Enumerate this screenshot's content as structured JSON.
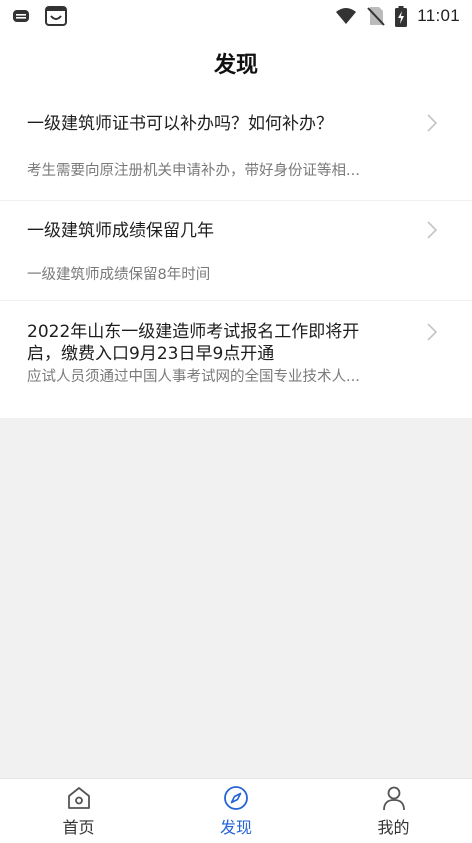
{
  "status_bar": {
    "time": "11:01",
    "left_icons": [
      "message-icon",
      "store-icon"
    ],
    "right_icons": [
      "wifi-icon",
      "no-sim-icon",
      "battery-charging-icon"
    ]
  },
  "header": {
    "title": "发现"
  },
  "articles": [
    {
      "title": "一级建筑师证书可以补办吗？如何补办？",
      "summary": "考生需要向原注册机关申请补办，带好身份证等相..."
    },
    {
      "title": "一级建筑师成绩保留几年",
      "summary": "一级建筑师成绩保留8年时间"
    },
    {
      "title": "2022年山东一级建造师考试报名工作即将开启，缴费入口9月23日早9点开通",
      "summary": "应试人员须通过中国人事考试网的全国专业技术人..."
    }
  ],
  "bottom_nav": {
    "active_color": "#2563d6",
    "items": [
      {
        "label": "首页",
        "icon": "home-icon",
        "active": false
      },
      {
        "label": "发现",
        "icon": "compass-icon",
        "active": true
      },
      {
        "label": "我的",
        "icon": "user-icon",
        "active": false
      }
    ]
  }
}
